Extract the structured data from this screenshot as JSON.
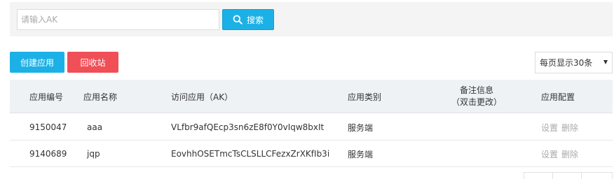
{
  "search": {
    "placeholder": "请输入AK",
    "button_label": "搜索"
  },
  "toolbar": {
    "create_label": "创建应用",
    "recycle_label": "回收站",
    "page_size_label": "每页显示30条"
  },
  "table": {
    "headers": {
      "id": "应用编号",
      "name": "应用名称",
      "ak": "访问应用（AK）",
      "type": "应用类别",
      "remark_line1": "备注信息",
      "remark_line2": "（双击更改）",
      "config": "应用配置"
    },
    "rows": [
      {
        "id": "9150047",
        "name": "aaa",
        "ak": "VLfbr9afQEcp3sn6zE8f0Y0vIqw8bxIt",
        "type": "服务端",
        "remark": "",
        "settings": "设置",
        "delete": "删除"
      },
      {
        "id": "9140689",
        "name": "jqp",
        "ak": "EovhhOSETmcTsCLSLLCFezxZrXKfIb3i",
        "type": "服务端",
        "remark": "",
        "settings": "设置",
        "delete": "删除"
      }
    ]
  },
  "colors": {
    "primary": "#1cb1e6",
    "danger": "#f04f57",
    "header_bg": "#eff2f5"
  }
}
